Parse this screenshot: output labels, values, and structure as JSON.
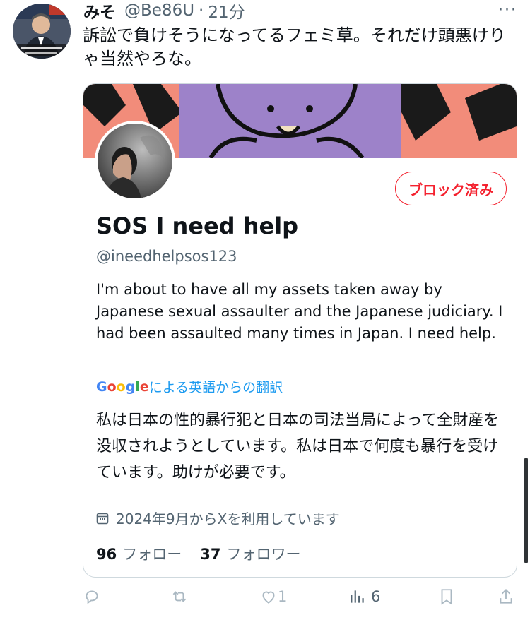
{
  "tweet": {
    "author_name": "みそ",
    "author_handle": "@Be86U",
    "separator": "·",
    "time": "21分",
    "more_label": "···",
    "text": "訴訟で負けそうになってるフェミ草。それだけ頭悪けりゃ当然やろな。"
  },
  "card": {
    "block_label": "ブロック済み",
    "profile_name": "SOS I need help",
    "profile_handle": "@ineedhelpsos123",
    "bio_en": "I'm about to have all my assets taken away by Japanese sexual assaulter and the Japanese judiciary. I had been assaulted many times in Japan. I need help.",
    "translate_label": "による英語からの翻訳",
    "bio_ja": "私は日本の性的暴行犯と日本の司法当局によって全財産を没収されようとしています。私は日本で何度も暴行を受けています。助けが必要です。",
    "joined": "2024年9月からXを利用しています",
    "following_count": "96",
    "following_label": "フォロー",
    "followers_count": "37",
    "followers_label": "フォロワー"
  },
  "actions": {
    "reply_count": "",
    "retweet_count": "",
    "like_count": "1",
    "views_count": "6"
  },
  "colors": {
    "block_red": "#f4212e",
    "link_blue": "#1d9bf0",
    "secondary": "#536471",
    "banner_purple": "#9d82c9",
    "banner_salmon": "#f28c7a"
  },
  "icons": [
    "more-icon",
    "calendar-icon",
    "google-logo",
    "reply-icon",
    "retweet-icon",
    "like-icon",
    "views-icon",
    "bookmark-icon",
    "share-icon"
  ]
}
